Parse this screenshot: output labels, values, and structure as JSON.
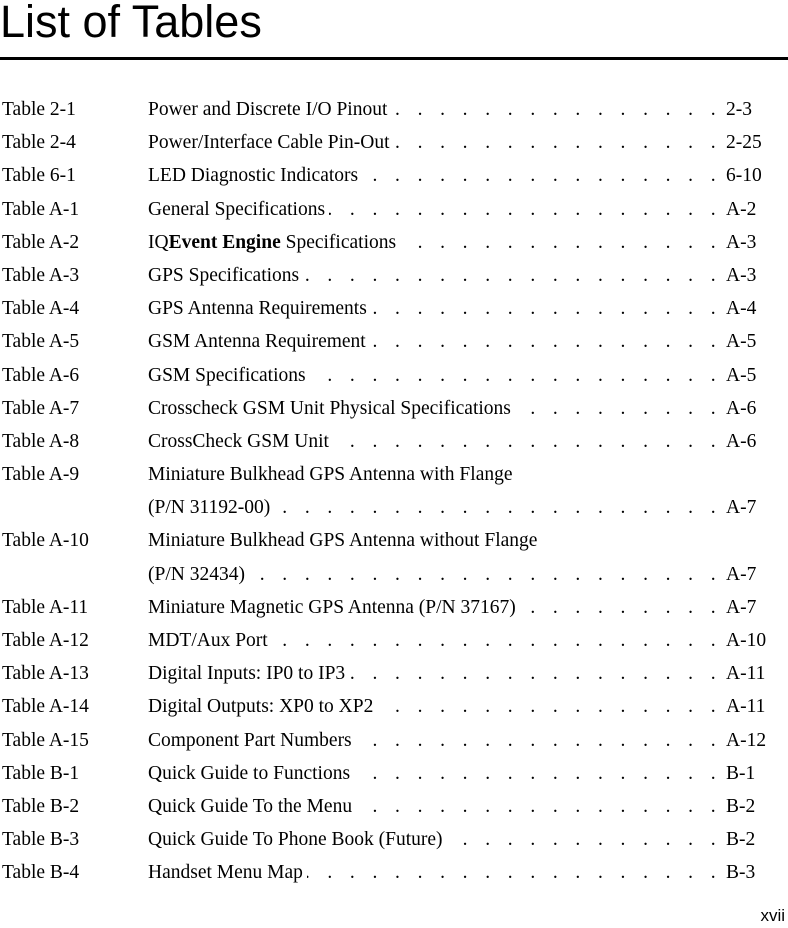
{
  "page": {
    "title": "List of Tables",
    "folio": "xvii",
    "leader_dots": ". . . . . . . . . . . . . . . . . . . . . . . . . . . . . . . . . . . ."
  },
  "entries": [
    {
      "number": "Table 2-1",
      "title": "Power and Discrete I/O Pinout",
      "page": "2-3"
    },
    {
      "number": "Table 2-4",
      "title": "Power/Interface Cable Pin-Out",
      "page": "2-25"
    },
    {
      "number": "Table 6-1",
      "title": "LED Diagnostic Indicators",
      "page": "6-10"
    },
    {
      "number": "Table A-1",
      "title": "General Specifications",
      "page": "A-2"
    },
    {
      "number": "Table A-2",
      "title_prefix": "IQ",
      "title_bold": "Event Engine",
      "title_suffix": " Specifications",
      "page": "A-3"
    },
    {
      "number": "Table A-3",
      "title": "GPS Specifications",
      "page": "A-3"
    },
    {
      "number": "Table A-4",
      "title": "GPS Antenna Requirements",
      "page": "A-4"
    },
    {
      "number": "Table A-5",
      "title": "GSM Antenna Requirement",
      "page": "A-5"
    },
    {
      "number": "Table A-6",
      "title": "GSM Specifications",
      "page": "A-5"
    },
    {
      "number": "Table A-7",
      "title": "Crosscheck GSM Unit Physical Specifications",
      "page": "A-6"
    },
    {
      "number": "Table A-8",
      "title": "CrossCheck GSM Unit",
      "page": "A-6"
    },
    {
      "number": "Table A-9",
      "title_line1": "Miniature Bulkhead GPS Antenna with Flange",
      "title_line2": "(P/N 31192-00)",
      "page": "A-7"
    },
    {
      "number": "Table A-10",
      "title_line1": "Miniature Bulkhead GPS Antenna without Flange",
      "title_line2": "(P/N 32434)",
      "page": "A-7"
    },
    {
      "number": "Table A-11",
      "title": "Miniature Magnetic GPS Antenna (P/N 37167)",
      "page": "A-7"
    },
    {
      "number": "Table A-12",
      "title": "MDT/Aux Port",
      "page": "A-10"
    },
    {
      "number": "Table A-13",
      "title": "Digital Inputs: IP0 to IP3",
      "page": "A-11"
    },
    {
      "number": "Table A-14",
      "title": "Digital Outputs: XP0 to XP2",
      "page": "A-11"
    },
    {
      "number": "Table A-15",
      "title": "Component Part Numbers",
      "page": "A-12"
    },
    {
      "number": "Table B-1",
      "title": "Quick Guide to Functions",
      "page": "B-1"
    },
    {
      "number": "Table B-2",
      "title": "Quick Guide To the Menu",
      "page": "B-2"
    },
    {
      "number": "Table B-3",
      "title": "Quick Guide To Phone Book (Future)",
      "page": "B-2"
    },
    {
      "number": "Table B-4",
      "title": "Handset Menu Map",
      "page": "B-3"
    }
  ]
}
